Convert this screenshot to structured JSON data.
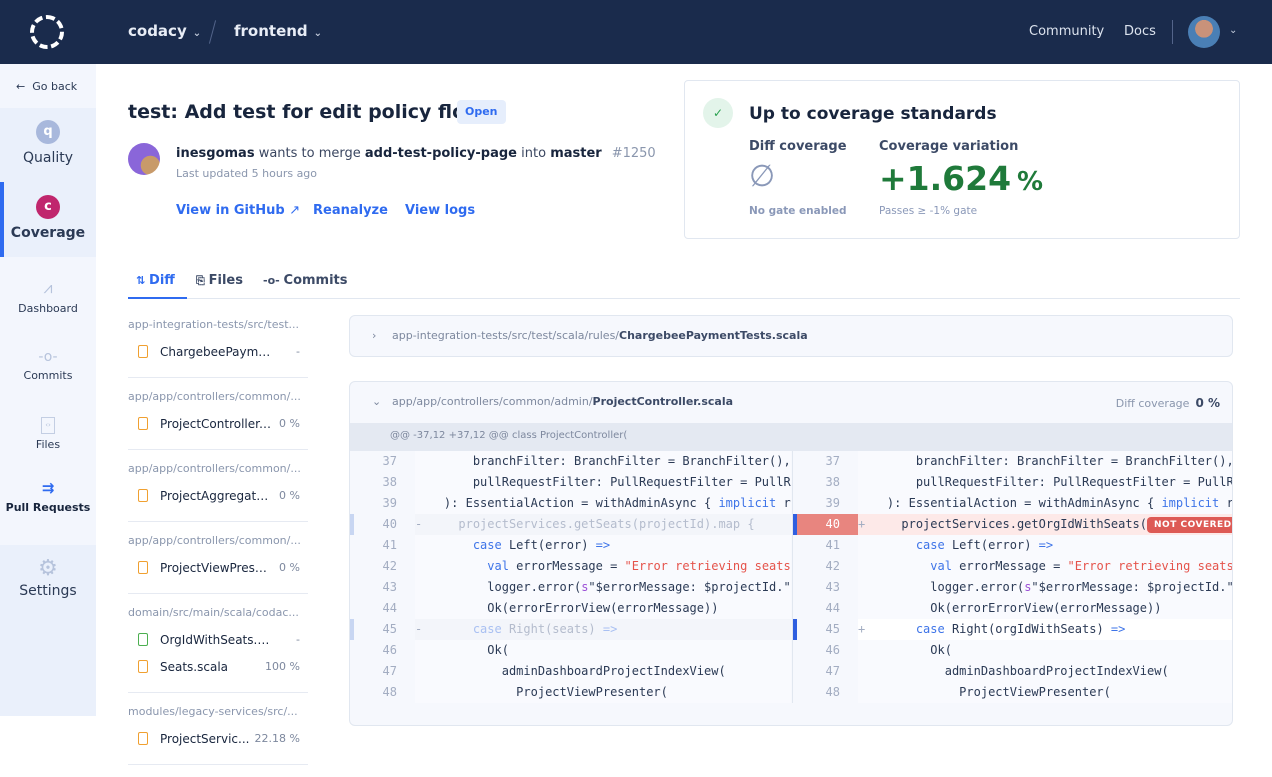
{
  "topbar": {
    "org": "codacy",
    "repo": "frontend",
    "links": [
      "Community",
      "Docs"
    ]
  },
  "sidebar": {
    "go_back": "Go back",
    "quality": {
      "label": "Quality",
      "letter": "q"
    },
    "coverage": {
      "label": "Coverage",
      "letter": "c"
    },
    "items": [
      "Dashboard",
      "Commits",
      "Files",
      "Pull Requests"
    ],
    "settings": "Settings",
    "active": "Pull Requests"
  },
  "pr": {
    "title": "test: Add test for edit policy flow",
    "status": "Open",
    "author": "inesgomas",
    "wants": "wants to merge",
    "source": "add-test-policy-page",
    "into": "into",
    "target": "master",
    "number": "#1250",
    "updated": "Last updated 5 hours ago",
    "actions": [
      "View in GitHub",
      "Reanalyze",
      "View logs"
    ]
  },
  "coverage_card": {
    "title": "Up to coverage standards",
    "diff_label": "Diff coverage",
    "diff_value": "∅",
    "diff_sub": "No gate enabled",
    "var_label": "Coverage variation",
    "var_value": "+1.624",
    "var_unit": "%",
    "var_sub": "Passes ≥ -1% gate"
  },
  "tabs": [
    "Diff",
    "Files",
    "Commits"
  ],
  "files": [
    {
      "path": "app-integration-tests/src/test...",
      "items": [
        {
          "name": "ChargebeePaymentT...",
          "cov": "-",
          "new": false
        }
      ]
    },
    {
      "path": "app/app/controllers/common/...",
      "items": [
        {
          "name": "ProjectController.s...",
          "cov": "0 %",
          "new": false
        }
      ]
    },
    {
      "path": "app/app/controllers/common/...",
      "items": [
        {
          "name": "ProjectAggregator....",
          "cov": "0 %",
          "new": false
        }
      ]
    },
    {
      "path": "app/app/controllers/common/...",
      "items": [
        {
          "name": "ProjectViewPresen...",
          "cov": "0 %",
          "new": false
        }
      ]
    },
    {
      "path": "domain/src/main/scala/codac...",
      "items": [
        {
          "name": "OrgIdWithSeats.scala",
          "cov": "-",
          "new": true
        },
        {
          "name": "Seats.scala",
          "cov": "100 %",
          "new": false
        }
      ]
    },
    {
      "path": "modules/legacy-services/src/...",
      "items": [
        {
          "name": "ProjectServic...",
          "cov": "22.18 %",
          "new": false
        }
      ]
    }
  ],
  "diff1": {
    "dir": "app-integration-tests/src/test/scala/rules/",
    "file": "ChargebeePaymentTests.scala"
  },
  "diff2": {
    "dir": "app/app/controllers/common/admin/",
    "file": "ProjectController.scala",
    "cov_label": "Diff coverage",
    "cov_value": "0 %",
    "hunk": "@@ -37,12 +37,12 @@ class ProjectController(",
    "badge": "NOT COVERED",
    "left": [
      {
        "n": "37",
        "m": " ",
        "s": [
          [
            "      branchFilter: BranchFilter = BranchFilter(),",
            ""
          ]
        ]
      },
      {
        "n": "38",
        "m": " ",
        "s": [
          [
            "      pullRequestFilter: PullRequestFilter = PullRequestFilter()",
            ""
          ]
        ]
      },
      {
        "n": "39",
        "m": " ",
        "s": [
          [
            "  ): EssentialAction = withAdminAsync { ",
            ""
          ],
          [
            "implicit",
            "kw"
          ],
          [
            " request =>",
            ""
          ]
        ]
      },
      {
        "n": "40",
        "m": "-",
        "t": "removed",
        "s": [
          [
            "    projectServices.getSeats(projectId).map {",
            ""
          ]
        ]
      },
      {
        "n": "41",
        "m": " ",
        "s": [
          [
            "      ",
            ""
          ],
          [
            "case",
            "kw"
          ],
          [
            " Left(error) ",
            ""
          ],
          [
            "=>",
            "kw"
          ]
        ]
      },
      {
        "n": "42",
        "m": " ",
        "s": [
          [
            "        ",
            ""
          ],
          [
            "val",
            "kw"
          ],
          [
            " errorMessage = ",
            ""
          ],
          [
            "\"Error retrieving seats\"",
            "str"
          ]
        ]
      },
      {
        "n": "43",
        "m": " ",
        "s": [
          [
            "        logger.error(",
            ""
          ],
          [
            "s",
            "intp"
          ],
          [
            "\"$errorMessage: $projectId.\")",
            ""
          ]
        ]
      },
      {
        "n": "44",
        "m": " ",
        "s": [
          [
            "        Ok(errorErrorView(errorMessage))",
            ""
          ]
        ]
      },
      {
        "n": "45",
        "m": "-",
        "t": "removed",
        "s": [
          [
            "      ",
            ""
          ],
          [
            "case",
            "kw"
          ],
          [
            " Right(seats) ",
            ""
          ],
          [
            "=>",
            "kw"
          ]
        ]
      },
      {
        "n": "46",
        "m": " ",
        "s": [
          [
            "        Ok(",
            ""
          ]
        ]
      },
      {
        "n": "47",
        "m": " ",
        "s": [
          [
            "          adminDashboardProjectIndexView(",
            ""
          ]
        ]
      },
      {
        "n": "48",
        "m": " ",
        "s": [
          [
            "            ProjectViewPresenter(",
            ""
          ]
        ]
      }
    ],
    "right": [
      {
        "n": "37",
        "m": " ",
        "s": [
          [
            "      branchFilter: BranchFilter = BranchFilter(),",
            ""
          ]
        ]
      },
      {
        "n": "38",
        "m": " ",
        "s": [
          [
            "      pullRequestFilter: PullRequestFilter = PullRequestFilter()",
            ""
          ]
        ]
      },
      {
        "n": "39",
        "m": " ",
        "s": [
          [
            "  ): EssentialAction = withAdminAsync { ",
            ""
          ],
          [
            "implicit",
            "kw"
          ],
          [
            " request =>",
            ""
          ]
        ]
      },
      {
        "n": "40",
        "m": "+",
        "t": "uncovered",
        "s": [
          [
            "    projectServices.getOrgIdWithSeats(",
            ""
          ]
        ],
        "badge": true
      },
      {
        "n": "41",
        "m": " ",
        "s": [
          [
            "      ",
            ""
          ],
          [
            "case",
            "kw"
          ],
          [
            " Left(error) ",
            ""
          ],
          [
            "=>",
            "kw"
          ]
        ]
      },
      {
        "n": "42",
        "m": " ",
        "s": [
          [
            "        ",
            ""
          ],
          [
            "val",
            "kw"
          ],
          [
            " errorMessage = ",
            ""
          ],
          [
            "\"Error retrieving seats\"",
            "str"
          ]
        ]
      },
      {
        "n": "43",
        "m": " ",
        "s": [
          [
            "        logger.error(",
            ""
          ],
          [
            "s",
            "intp"
          ],
          [
            "\"$errorMessage: $projectId.\")",
            ""
          ]
        ]
      },
      {
        "n": "44",
        "m": " ",
        "s": [
          [
            "        Ok(errorErrorView(errorMessage))",
            ""
          ]
        ]
      },
      {
        "n": "45",
        "m": "+",
        "t": "plain",
        "s": [
          [
            "      ",
            ""
          ],
          [
            "case",
            "kw"
          ],
          [
            " Right(orgIdWithSeats) ",
            ""
          ],
          [
            "=>",
            "kw"
          ]
        ]
      },
      {
        "n": "46",
        "m": " ",
        "s": [
          [
            "        Ok(",
            ""
          ]
        ]
      },
      {
        "n": "47",
        "m": " ",
        "s": [
          [
            "          adminDashboardProjectIndexView(",
            ""
          ]
        ]
      },
      {
        "n": "48",
        "m": " ",
        "s": [
          [
            "            ProjectViewPresenter(",
            ""
          ]
        ]
      }
    ]
  },
  "colors": {
    "header": "#1a2b4c",
    "accent": "#2f6bf0",
    "quality": "#a8b8dc",
    "coverage": "#c0266d",
    "positive": "#1f7a3a",
    "not_covered": "#dd5a55"
  }
}
